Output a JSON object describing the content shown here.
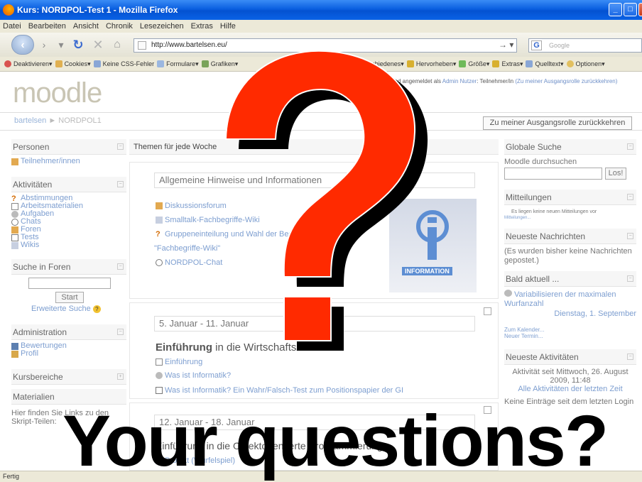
{
  "window": {
    "title": "Kurs: NORDPOL-Test 1 - Mozilla Firefox"
  },
  "menu": [
    "Datei",
    "Bearbeiten",
    "Ansicht",
    "Chronik",
    "Lesezeichen",
    "Extras",
    "Hilfe"
  ],
  "nav": {
    "url": "http://www.bartelsen.eu/",
    "search_placeholder": "Google"
  },
  "webdev": {
    "items": [
      "Deaktivieren",
      "Cookies",
      "Keine CSS-Fehler",
      "Formulare",
      "Grafiken",
      "Verschiedenes",
      "Hervorheben",
      "Größe",
      "Extras",
      "Quelltext",
      "Optionen"
    ]
  },
  "moodle": {
    "logo": "moodle",
    "login_prefix": "Sie sind angemeldet als",
    "login_user": "Admin Nutzer",
    "login_role": "Teilnehmer/in",
    "login_return": "(Zu meiner Ausgangsrolle zurückkehren)",
    "breadcrumb_home": "bartelsen",
    "breadcrumb_sep": "►",
    "breadcrumb_course": "NORDPOL1",
    "role_button": "Zu meiner Ausgangsrolle zurückkehren"
  },
  "left": {
    "personen": {
      "title": "Personen",
      "items": [
        "Teilnehmer/innen"
      ]
    },
    "aktivitaeten": {
      "title": "Aktivitäten",
      "items": [
        "Abstimmungen",
        "Arbeitsmaterialien",
        "Aufgaben",
        "Chats",
        "Foren",
        "Tests",
        "Wikis"
      ]
    },
    "suche": {
      "title": "Suche in Foren",
      "button": "Start",
      "advanced": "Erweiterte Suche"
    },
    "admin": {
      "title": "Administration",
      "items": [
        "Bewertungen",
        "Profil"
      ]
    },
    "kursbereiche": {
      "title": "Kursbereiche"
    },
    "materialien": {
      "title": "Materialien",
      "text_line1": "Hier finden Sie Links zu den",
      "text_line2": "Skript-Teilen:"
    }
  },
  "center": {
    "header": "Themen für jede Woche",
    "sections": [
      {
        "title": "Allgemeine Hinweise und Informationen",
        "items": [
          "Diskussionsforum",
          "Smalltalk-Fachbegriffe-Wiki",
          "Gruppeneinteilung und Wahl der Begriffe für das",
          "\"Fachbegriffe-Wiki\"",
          "NORDPOL-Chat"
        ],
        "image_caption": "INFORMATION"
      },
      {
        "title": "5. Januar - 11. Januar",
        "heading_a": "Einführung",
        "heading_b": "in die Wirtschafts",
        "heading_c": "informatik",
        "items": [
          "Einführung",
          "Was ist Informatik?",
          "Was ist Informatik? Ein Wahr/Falsch-Test zum Positionspapier der GI"
        ]
      },
      {
        "title": "12. Januar - 18. Januar",
        "heading": "Einführung in die Objektorientierte Programmierung",
        "items": [
          "Projekt (Würfelspiel)"
        ]
      }
    ]
  },
  "right": {
    "suche": {
      "title": "Globale Suche",
      "label": "Moodle durchsuchen",
      "button": "Los!"
    },
    "mitteilungen": {
      "title": "Mitteilungen",
      "text": "Es liegen keine neuen Mitteilungen vor",
      "link": "Mitteilungen..."
    },
    "nachrichten": {
      "title": "Neueste Nachrichten",
      "text": "(Es wurden bisher keine Nachrichten gepostet.)"
    },
    "bald": {
      "title": "Bald aktuell ...",
      "event": "Variabilisieren der maximalen Wurfanzahl",
      "date": "Dienstag, 1. September",
      "calendar": "Zum Kalender...",
      "new": "Neuer Termin..."
    },
    "aktivitaeten": {
      "title": "Neueste Aktivitäten",
      "since": "Aktivität seit Mittwoch, 26. August 2009, 11:48",
      "link": "Alle Aktivitäten der letzten Zeit",
      "none": "Keine Einträge seit dem letzten Login"
    }
  },
  "status": "Fertig",
  "overlay": {
    "big_text": "Your questions?"
  },
  "colors": {
    "qmark": "#ff2a00",
    "qmark_shadow": "#000000",
    "link": "#7d9ed0"
  }
}
